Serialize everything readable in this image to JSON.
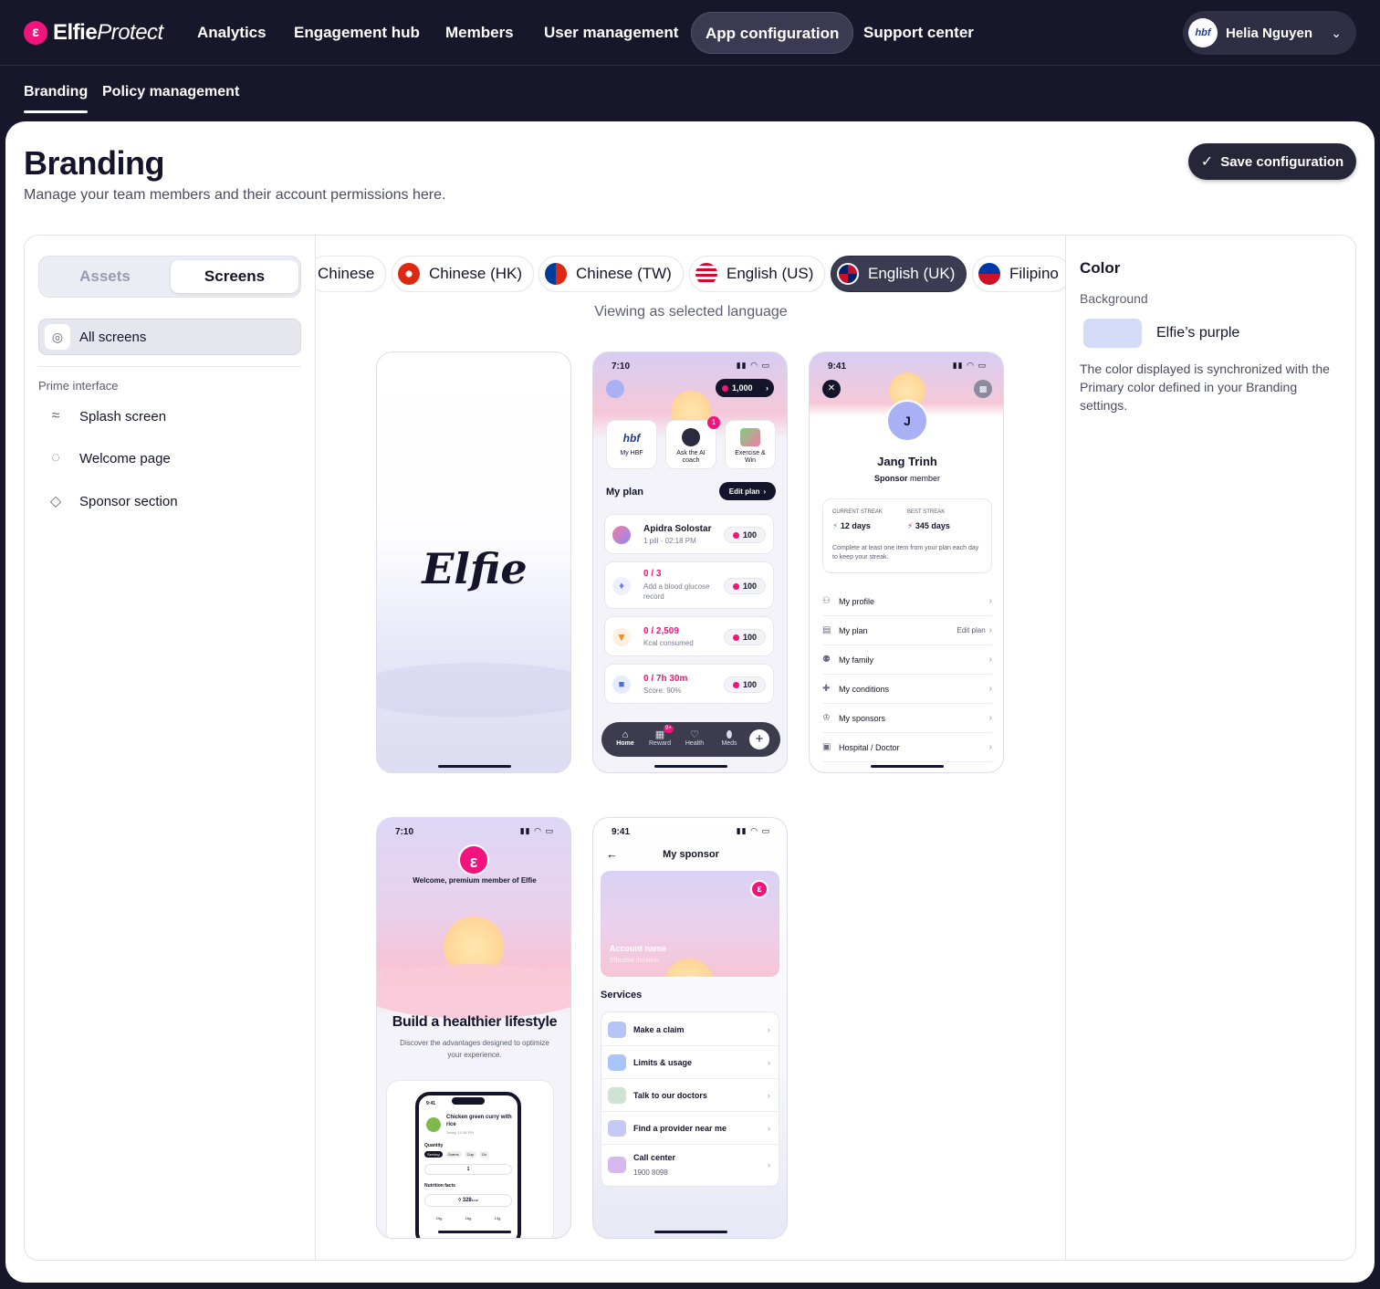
{
  "app": {
    "logo_bold": "Elfie",
    "logo_italic": "Protect",
    "logo_mark": "ε"
  },
  "nav": {
    "items": [
      "Analytics",
      "Engagement hub",
      "Members",
      "User management",
      "App configuration",
      "Support center"
    ],
    "active": "App configuration"
  },
  "user": {
    "avatar_text": "hbf",
    "name": "Helia Nguyen"
  },
  "subnav": {
    "tabs": [
      "Branding",
      "Policy management"
    ],
    "active": "Branding"
  },
  "page": {
    "title": "Branding",
    "subtitle": "Manage your team members and their account permissions here.",
    "save_label": "Save configuration"
  },
  "left_panel": {
    "segments": [
      "Assets",
      "Screens"
    ],
    "active_segment": "Screens",
    "all_screens_label": "All screens",
    "group_header": "Prime interface",
    "screens": [
      {
        "label": "Splash screen",
        "icon": "wave-icon"
      },
      {
        "label": "Welcome page",
        "icon": "chat-icon"
      },
      {
        "label": "Sponsor section",
        "icon": "diamond-icon"
      }
    ]
  },
  "languages": {
    "chips": [
      {
        "label": "Chinese",
        "flag": "none"
      },
      {
        "label": "Chinese (HK)",
        "flag": "hk-flag-icon"
      },
      {
        "label": "Chinese (TW)",
        "flag": "tw-flag-icon"
      },
      {
        "label": "English (US)",
        "flag": "us-flag-icon"
      },
      {
        "label": "English (UK)",
        "flag": "uk-flag-icon"
      },
      {
        "label": "Filipino",
        "flag": "ph-flag-icon"
      }
    ],
    "active": "English (UK)",
    "viewing_label": "Viewing as selected language"
  },
  "screens_preview": {
    "splash": {
      "logo": "Elfie"
    },
    "home": {
      "time": "7:10",
      "points_badge": "1,000",
      "notif_count": "1",
      "tiles": [
        "My HBF",
        "Ask the AI coach",
        "Exercise & Win"
      ],
      "tile_logo": "hbf",
      "plan_title": "My plan",
      "edit_plan": "Edit plan",
      "items": [
        {
          "title": "Apidra Solostar",
          "sub": "1 pill · 02:18 PM",
          "points": "100"
        },
        {
          "title": "0 / 3",
          "sub": "Add a blood glucose record",
          "points": "100"
        },
        {
          "title": "0 / 2,509",
          "sub": "Kcal consumed",
          "points": "100"
        },
        {
          "title": "0 / 7h 30m",
          "sub": "Score: 90%",
          "points": "100"
        }
      ],
      "tabbar": [
        "Home",
        "Reward",
        "Health",
        "Meds"
      ],
      "reward_badge": "9+"
    },
    "profile": {
      "time": "9:41",
      "avatar_initial": "J",
      "name": "Jang Trinh",
      "role_bold": "Sponsor",
      "role_rest": "member",
      "current_streak_label": "CURRENT STREAK",
      "current_streak": "12 days",
      "best_streak_label": "BEST STREAK",
      "best_streak": "345 days",
      "streak_note": "Complete at least one item from your plan each day to keep your streak.",
      "menu": [
        "My profile",
        "My plan",
        "My family",
        "My conditions",
        "My sponsors",
        "Hospital / Doctor"
      ],
      "menu_extra": "Edit plan"
    },
    "welcome": {
      "time": "7:10",
      "welcome_text": "Welcome, premium member of Elfie",
      "headline": "Build a healthier lifestyle",
      "body": "Discover the advantages designed to optimize your experience.",
      "mini": {
        "time": "9:41",
        "dish": "Chicken green curry with rice",
        "date": "Today, 12:36 PM",
        "quantity_label": "Quantity",
        "units": [
          "Serving",
          "Grams",
          "Cup",
          "Oz"
        ],
        "qty": "1",
        "nutrition_label": "Nutrition facts",
        "kcal": "328",
        "kcal_unit": "kcal",
        "macros": [
          "29g",
          "16g",
          "13g"
        ]
      }
    },
    "sponsor": {
      "time": "9:41",
      "title": "My sponsor",
      "account_name": "Account name",
      "effective": "Effective duration",
      "services_label": "Services",
      "services": [
        {
          "label": "Make a claim",
          "sub": ""
        },
        {
          "label": "Limits & usage",
          "sub": ""
        },
        {
          "label": "Talk to our doctors",
          "sub": ""
        },
        {
          "label": "Find a provider near me",
          "sub": ""
        },
        {
          "label": "Call center",
          "sub": "1900 8098"
        }
      ]
    }
  },
  "right_panel": {
    "heading": "Color",
    "background_label": "Background",
    "swatch_color": "#d3dbf8",
    "swatch_name": "Elfie’s purple",
    "description": "The color displayed is synchronized with the Primary color defined in your Branding settings."
  },
  "colors": {
    "brand_pink": "#f2137d",
    "dark_bg": "#17172b",
    "active_chip": "#3b3b52"
  }
}
